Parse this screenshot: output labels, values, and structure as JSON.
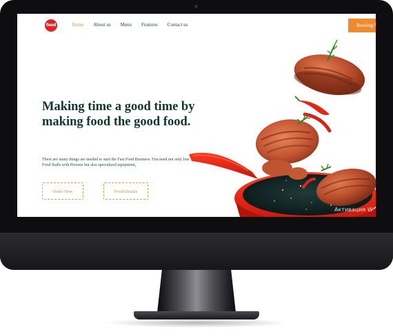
{
  "brand": {
    "logo_text": "food"
  },
  "nav": {
    "items": [
      {
        "label": "Home",
        "active": true
      },
      {
        "label": "About us",
        "active": false
      },
      {
        "label": "Menu",
        "active": false
      },
      {
        "label": "Features",
        "active": false
      },
      {
        "label": "Contact us",
        "active": false
      }
    ],
    "cta_label": "Booking N"
  },
  "hero": {
    "title": "Making time a good time by making food the good food.",
    "description": "There are many things are needed to start the Fast Food Business. You need not only Just Food Stalls with Persons but also specialized equipment,",
    "order_button": "Order Now",
    "details_button": "Food Details"
  },
  "overlay": {
    "watermark": "Активация W"
  },
  "colors": {
    "accent": "#f08a2c",
    "heading": "#123633",
    "nav_text": "#1b4a46",
    "pan_red": "#e2231a",
    "logo_red": "#e02323"
  },
  "icons": {
    "logo": "food-logo-icon",
    "hero": "frying-pan-steaks-image"
  }
}
